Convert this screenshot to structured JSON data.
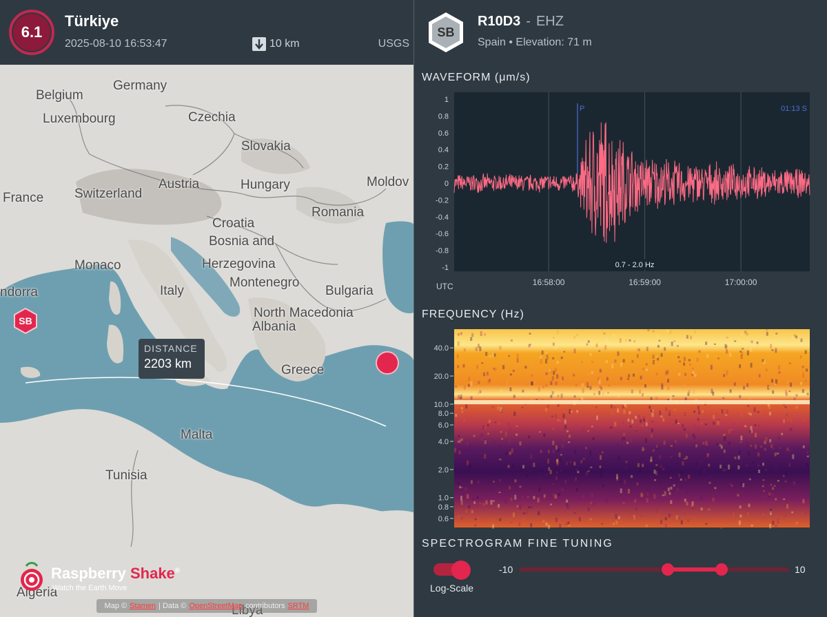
{
  "event": {
    "magnitude": "6.1",
    "region": "Türkiye",
    "datetime": "2025-08-10 16:53:47",
    "depth": "10 km",
    "source": "USGS"
  },
  "map": {
    "labels": {
      "belgium": "Belgium",
      "germany": "Germany",
      "luxembourg": "Luxembourg",
      "czechia": "Czechia",
      "slovakia": "Slovakia",
      "austria": "Austria",
      "switzerland": "Switzerland",
      "hungary": "Hungary",
      "moldova": "Moldov",
      "france": "France",
      "croatia": "Croatia",
      "romania": "Romania",
      "bosnia": "Bosnia and",
      "herzegovina": "Herzegovina",
      "monaco": "Monaco",
      "italy": "Italy",
      "montenegro": "Montenegro",
      "bulgaria": "Bulgaria",
      "andorra": "ndorra",
      "north_macedonia": "North Macedonia",
      "albania": "Albania",
      "greece": "Greece",
      "malta": "Malta",
      "tunisia": "Tunisia",
      "algeria": "Algeria",
      "libya": "Libya"
    },
    "station_marker": "SB",
    "distance_label": "DISTANCE",
    "distance_value": "2203 km",
    "logo_word1": "Raspberry",
    "logo_word2": "Shake",
    "logo_mark": "®",
    "logo_tagline": "Watch the Earth Move",
    "attribution": {
      "prefix": "Map ©",
      "link1": "Stamen",
      "mid": "| Data ©",
      "link2": "OpenStreetMap",
      "suffix": "contributors",
      "link3": "SRTM"
    },
    "colors": {
      "sea": "#6e9fb0",
      "land": "#dcdbd7",
      "route": "#ffffff",
      "quake": "#e2264d"
    }
  },
  "station": {
    "badge": "SB",
    "code": "R10D3",
    "separator": "-",
    "channel": "EHZ",
    "info": "Spain • Elevation: 71 m"
  },
  "waveform": {
    "title": "WAVEFORM  (μm/s)",
    "p_label": "P",
    "s_label": "01:13  S",
    "filter": "0.7 - 2.0 Hz",
    "utc_label": "UTC",
    "trace_color": "#ff6b85"
  },
  "frequency": {
    "title": "FREQUENCY  (Hz)"
  },
  "tuning": {
    "title": "SPECTROGRAM FINE TUNING",
    "log_label": "Log-Scale",
    "log_scale_enabled": true,
    "min_label": "-10",
    "max_label": "10",
    "range_min": -10,
    "range_max": 10,
    "range_low": 1,
    "range_high": 5
  },
  "chart_data": [
    {
      "type": "line",
      "title": "WAVEFORM  (μm/s)",
      "xlabel": "UTC",
      "ylabel": "",
      "ylim": [
        -1,
        1
      ],
      "yticks": [
        "1",
        "0.8",
        "0.6",
        "0.4",
        "0.2",
        "0",
        "-0.2",
        "-0.4",
        "-0.6",
        "-0.8",
        "-1"
      ],
      "xticks": [
        "16:58:00",
        "16:59:00",
        "17:00:00"
      ],
      "xlim": [
        "16:57:01",
        "17:00:43"
      ],
      "annotations": [
        "P",
        "01:13  S",
        "0.7 - 2.0 Hz"
      ],
      "p_arrival": "16:58:18",
      "envelope": [
        {
          "x": "16:57:05",
          "amp": 0.12
        },
        {
          "x": "16:57:40",
          "amp": 0.12
        },
        {
          "x": "16:58:10",
          "amp": 0.12
        },
        {
          "x": "16:58:18",
          "amp": 0.15
        },
        {
          "x": "16:58:25",
          "amp": 0.75
        },
        {
          "x": "16:58:32",
          "amp": 1.0
        },
        {
          "x": "16:58:40",
          "amp": 0.8
        },
        {
          "x": "16:58:55",
          "amp": 0.4
        },
        {
          "x": "16:59:20",
          "amp": 0.3
        },
        {
          "x": "16:59:50",
          "amp": 0.25
        },
        {
          "x": "17:00:20",
          "amp": 0.2
        },
        {
          "x": "17:00:43",
          "amp": 0.18
        }
      ]
    },
    {
      "type": "heatmap",
      "title": "FREQUENCY  (Hz)",
      "ylabel": "",
      "yscale": "log",
      "ylim": [
        0.55,
        50
      ],
      "yticks": [
        "40.0",
        "20.0",
        "10.0",
        "8.0",
        "6.0",
        "4.0",
        "2.0",
        "1.0",
        "0.8",
        "0.6"
      ],
      "colormap": "inferno",
      "bright_band_hz": 10.5
    }
  ]
}
